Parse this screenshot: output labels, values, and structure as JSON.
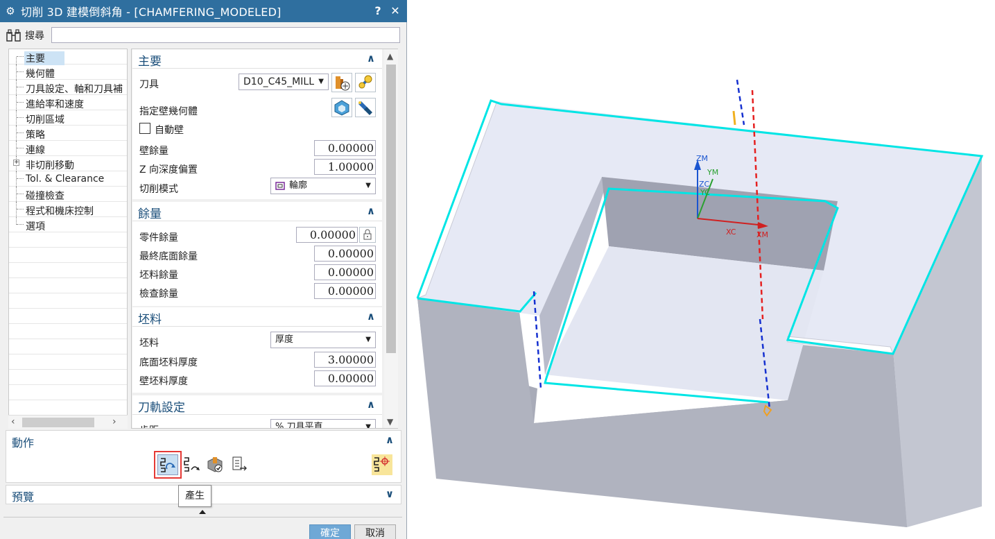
{
  "dialog": {
    "title": "切削 3D 建模倒斜角 - [CHAMFERING_MODELED]",
    "help_label": "?",
    "close_label": "✕",
    "search_label": "搜尋",
    "search_value": ""
  },
  "nav": {
    "items": [
      {
        "label": "主要"
      },
      {
        "label": "幾何體"
      },
      {
        "label": "刀具設定、軸和刀具補"
      },
      {
        "label": "進給率和速度"
      },
      {
        "label": "切削區域"
      },
      {
        "label": "策略"
      },
      {
        "label": "連線"
      },
      {
        "label": "非切削移動"
      },
      {
        "label": "Tol. & Clearance"
      },
      {
        "label": "碰撞檢查"
      },
      {
        "label": "程式和機床控制"
      },
      {
        "label": "選項"
      }
    ]
  },
  "groups": {
    "main": {
      "title": "主要",
      "tool_label": "刀具",
      "tool_value": "D10_C45_MILL",
      "wall_geom_label": "指定壁幾何體",
      "auto_wall_label": "自動壁",
      "wall_stock_label": "壁餘量",
      "wall_stock_value": "0.00000",
      "z_offset_label": "Z 向深度偏置",
      "z_offset_value": "1.00000",
      "cut_pattern_label": "切削模式",
      "cut_pattern_value": "輪廓"
    },
    "stock": {
      "title": "餘量",
      "part_stock_label": "零件餘量",
      "part_stock_value": "0.00000",
      "floor_stock_label": "最終底面餘量",
      "floor_stock_value": "0.00000",
      "blank_stock_label": "坯料餘量",
      "blank_stock_value": "0.00000",
      "check_stock_label": "檢查餘量",
      "check_stock_value": "0.00000"
    },
    "blank": {
      "title": "坯料",
      "blank_label": "坯料",
      "blank_value": "厚度",
      "floor_thk_label": "底面坯料厚度",
      "floor_thk_value": "3.00000",
      "wall_thk_label": "壁坯料厚度",
      "wall_thk_value": "0.00000"
    },
    "toolpath": {
      "title": "刀軌設定",
      "stepover_label": "步距",
      "stepover_value": "% 刀具平直"
    }
  },
  "actions": {
    "title": "動作"
  },
  "preview": {
    "title": "預覽"
  },
  "tooltip": "產生",
  "buttons": {
    "ok": "確定",
    "cancel": "取消"
  },
  "viewport": {
    "axes": {
      "zm": "ZM",
      "ym": "YM",
      "zc": "ZC",
      "yc": "YC",
      "xc": "XC",
      "xm": "XM"
    }
  },
  "colors": {
    "titlebar": "#2f6f9f",
    "accent": "#1a4e7a",
    "highlight": "#e53935",
    "selection": "#00e5e5"
  }
}
